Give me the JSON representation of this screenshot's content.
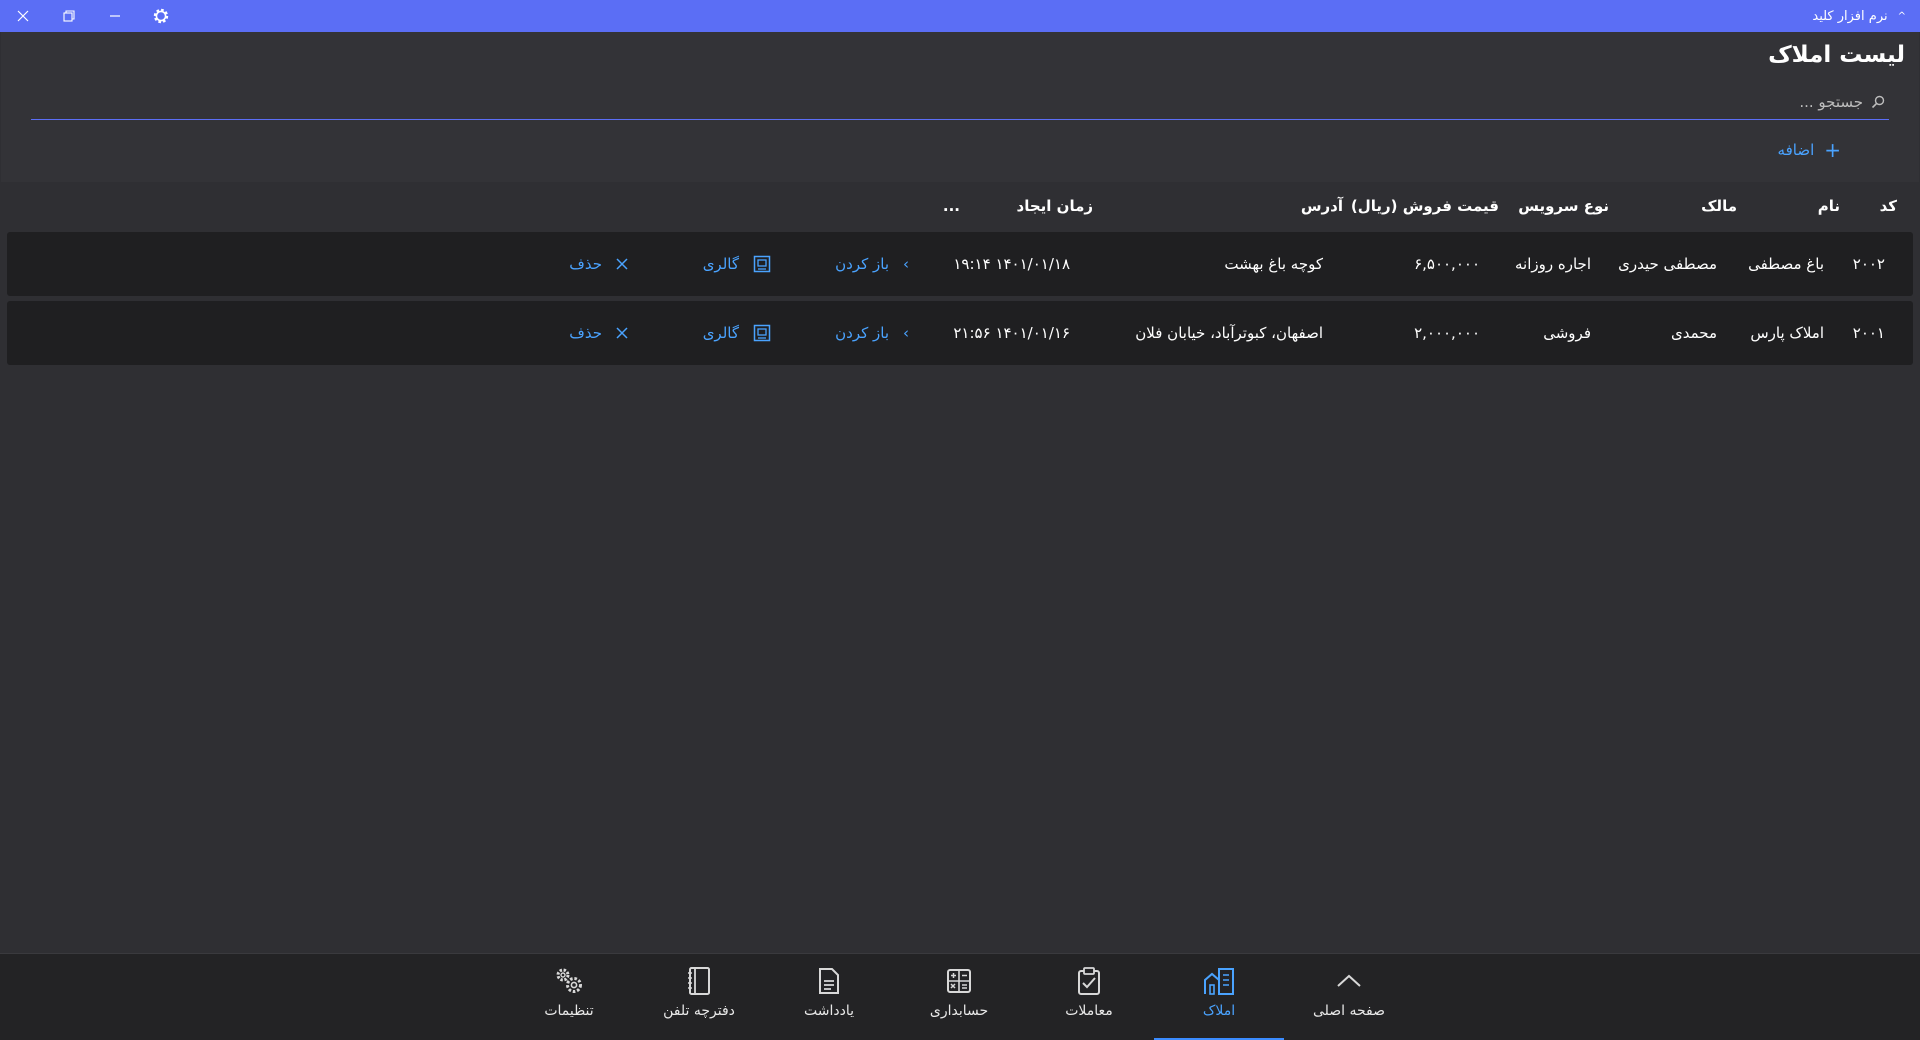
{
  "app": {
    "title": "نرم افزار کلید"
  },
  "page": {
    "title": "لیست املاک"
  },
  "search": {
    "placeholder": "جستجو ..."
  },
  "actions": {
    "add_label": "اضافه"
  },
  "table": {
    "headers": {
      "code": "کد",
      "name": "نام",
      "owner": "مالک",
      "service_type": "نوع سرویس",
      "price": "قیمت فروش (ریال)",
      "address": "آدرس",
      "created": "زمان ایجاد",
      "more": "..."
    },
    "rows": [
      {
        "code": "۲۰۰۲",
        "name": "باغ مصطفی",
        "owner": "مصطفی حیدری",
        "service_type": "اجاره روزانه",
        "price": "۶,۵۰۰,۰۰۰",
        "address": "کوچه باغ بهشت",
        "created": "۱۴۰۱/۰۱/۱۸ ۱۹:۱۴",
        "open_label": "باز کردن",
        "gallery_label": "گالری",
        "delete_label": "حذف"
      },
      {
        "code": "۲۰۰۱",
        "name": "املاک پارس",
        "owner": "محمدی",
        "service_type": "فروشی",
        "price": "۲,۰۰۰,۰۰۰",
        "address": "اصفهان، کبوترآباد، خیابان فلان",
        "created": "۱۴۰۱/۰۱/۱۶ ۲۱:۵۶",
        "open_label": "باز کردن",
        "gallery_label": "گالری",
        "delete_label": "حذف"
      }
    ]
  },
  "nav": {
    "items": [
      {
        "label": "صفحه اصلی",
        "icon": "home-chevron-icon",
        "active": false
      },
      {
        "label": "املاک",
        "icon": "buildings-icon",
        "active": true
      },
      {
        "label": "معاملات",
        "icon": "clipboard-check-icon",
        "active": false
      },
      {
        "label": "حسابداری",
        "icon": "calculator-icon",
        "active": false
      },
      {
        "label": "یادداشت",
        "icon": "note-icon",
        "active": false
      },
      {
        "label": "دفترچه تلفن",
        "icon": "phonebook-icon",
        "active": false
      },
      {
        "label": "تنظیمات",
        "icon": "gears-icon",
        "active": false
      }
    ]
  },
  "colors": {
    "titlebar": "#5b6ef5",
    "accent": "#4aa3ff",
    "background": "#2f2f33",
    "row": "#1f1f21",
    "bottom_bar": "#232325"
  }
}
